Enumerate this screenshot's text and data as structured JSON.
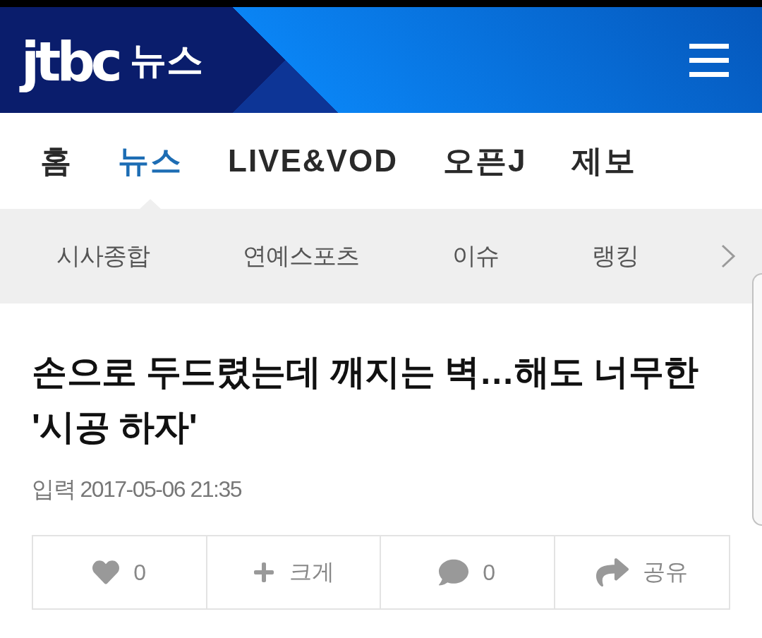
{
  "header": {
    "logo": "jtbc",
    "section": "뉴스"
  },
  "nav": {
    "tabs": [
      {
        "label": "홈",
        "selected": false
      },
      {
        "label": "뉴스",
        "selected": true
      },
      {
        "label": "LIVE&VOD",
        "selected": false
      },
      {
        "label": "오픈J",
        "selected": false
      },
      {
        "label": "제보",
        "selected": false
      }
    ]
  },
  "subnav": {
    "items": [
      "시사종합",
      "연예스포츠",
      "이슈",
      "랭킹"
    ]
  },
  "article": {
    "title": "손으로 두드렸는데 깨지는 벽…해도 너무한 '시공 하자'",
    "published": "입력 2017-05-06 21:35",
    "actions": [
      {
        "kind": "like",
        "label": "0"
      },
      {
        "kind": "enlarge",
        "label": "크게"
      },
      {
        "kind": "comment",
        "label": "0"
      },
      {
        "kind": "share",
        "label": "공유"
      }
    ]
  }
}
